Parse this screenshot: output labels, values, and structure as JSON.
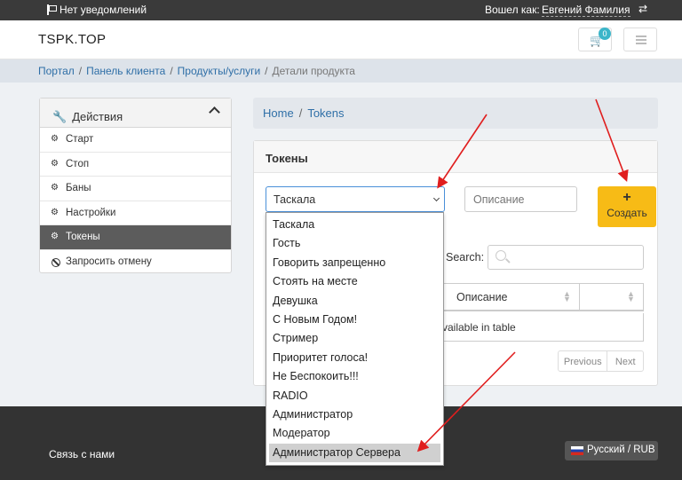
{
  "topbar": {
    "notifications": "Нет уведомлений",
    "logged_in_as": "Вошел как:",
    "username": "Евгений Фамилия"
  },
  "header": {
    "logo": "TSPK.TOP",
    "cart_count": "0"
  },
  "breadcrumb": {
    "items": [
      "Портал",
      "Панель клиента",
      "Продукты/услуги"
    ],
    "current": "Детали продукта"
  },
  "actions": {
    "title": "Действия",
    "items": [
      {
        "label": "Старт"
      },
      {
        "label": "Стоп"
      },
      {
        "label": "Баны"
      },
      {
        "label": "Настройки"
      },
      {
        "label": "Токены"
      },
      {
        "label": "Запросить отмену"
      }
    ]
  },
  "subcrumb": {
    "home": "Home",
    "current": "Tokens"
  },
  "tokens": {
    "title": "Токены",
    "selected": "Таскала",
    "description_placeholder": "Описание",
    "create_label": "Создать",
    "create_plus": "+",
    "search_label": "Search:",
    "column_description": "Описание",
    "empty_text": "vailable in table",
    "prev": "Previous",
    "next": "Next",
    "options": [
      "Таскала",
      "Гость",
      "Говорить запрещенно",
      "Стоять на месте",
      "Девушка",
      "С Новым Годом!",
      "Стример",
      "Приоритет голоса!",
      "Не Беспокоить!!!",
      "RADIO",
      "Администратор",
      "Модератор",
      "Администратор Сервера"
    ]
  },
  "footer": {
    "contact": "Связь с нами",
    "language": "Русский / RUB"
  },
  "colors": {
    "accent": "#f7bb16",
    "link": "#2f6fa7",
    "annotation_arrow": "#e01e1e"
  }
}
